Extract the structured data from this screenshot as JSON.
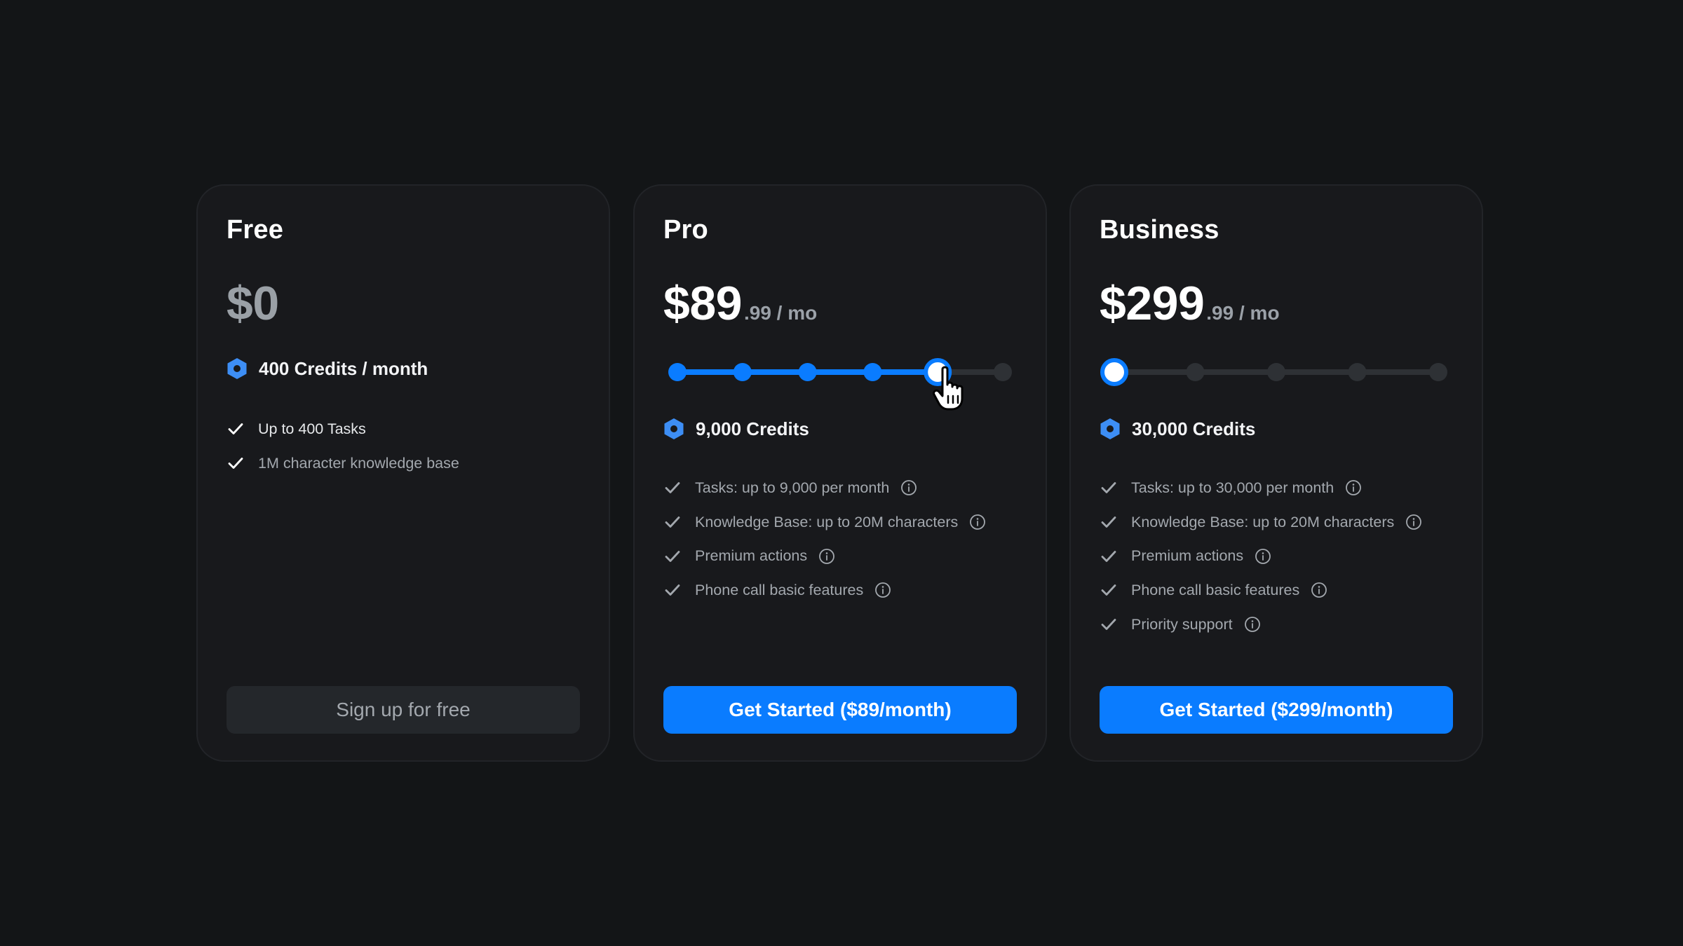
{
  "plans": [
    {
      "name": "Free",
      "price_main": "$0",
      "price_suffix": "",
      "credits": "400 Credits / month",
      "features": [
        "Up to 400 Tasks",
        "1M character knowledge base"
      ],
      "cta": "Sign up for free"
    },
    {
      "name": "Pro",
      "price_main": "$89",
      "price_suffix": ".99 / mo",
      "slider": {
        "steps": 6,
        "selected_index": 4
      },
      "credits": "9,000 Credits",
      "features": [
        "Tasks: up to 9,000 per month",
        "Knowledge Base: up to 20M characters",
        "Premium actions",
        "Phone call basic features"
      ],
      "cta": "Get Started ($89/month)"
    },
    {
      "name": "Business",
      "price_main": "$299",
      "price_suffix": ".99 / mo",
      "slider": {
        "steps": 5,
        "selected_index": 0
      },
      "credits": "30,000 Credits",
      "features": [
        "Tasks: up to 30,000 per month",
        "Knowledge Base: up to 20M characters",
        "Premium actions",
        "Phone call basic features",
        "Priority support"
      ],
      "cta": "Get Started ($299/month)"
    }
  ],
  "colors": {
    "accent": "#0a7cff",
    "background": "#131517",
    "card": "#18191c",
    "track_inactive": "#2e3135",
    "muted_text": "#a3a8ae"
  },
  "icons": {
    "credits": "hexagon-credit-icon",
    "feature": "check-icon",
    "info": "info-circle-icon",
    "pointer": "hand-pointer-icon"
  }
}
